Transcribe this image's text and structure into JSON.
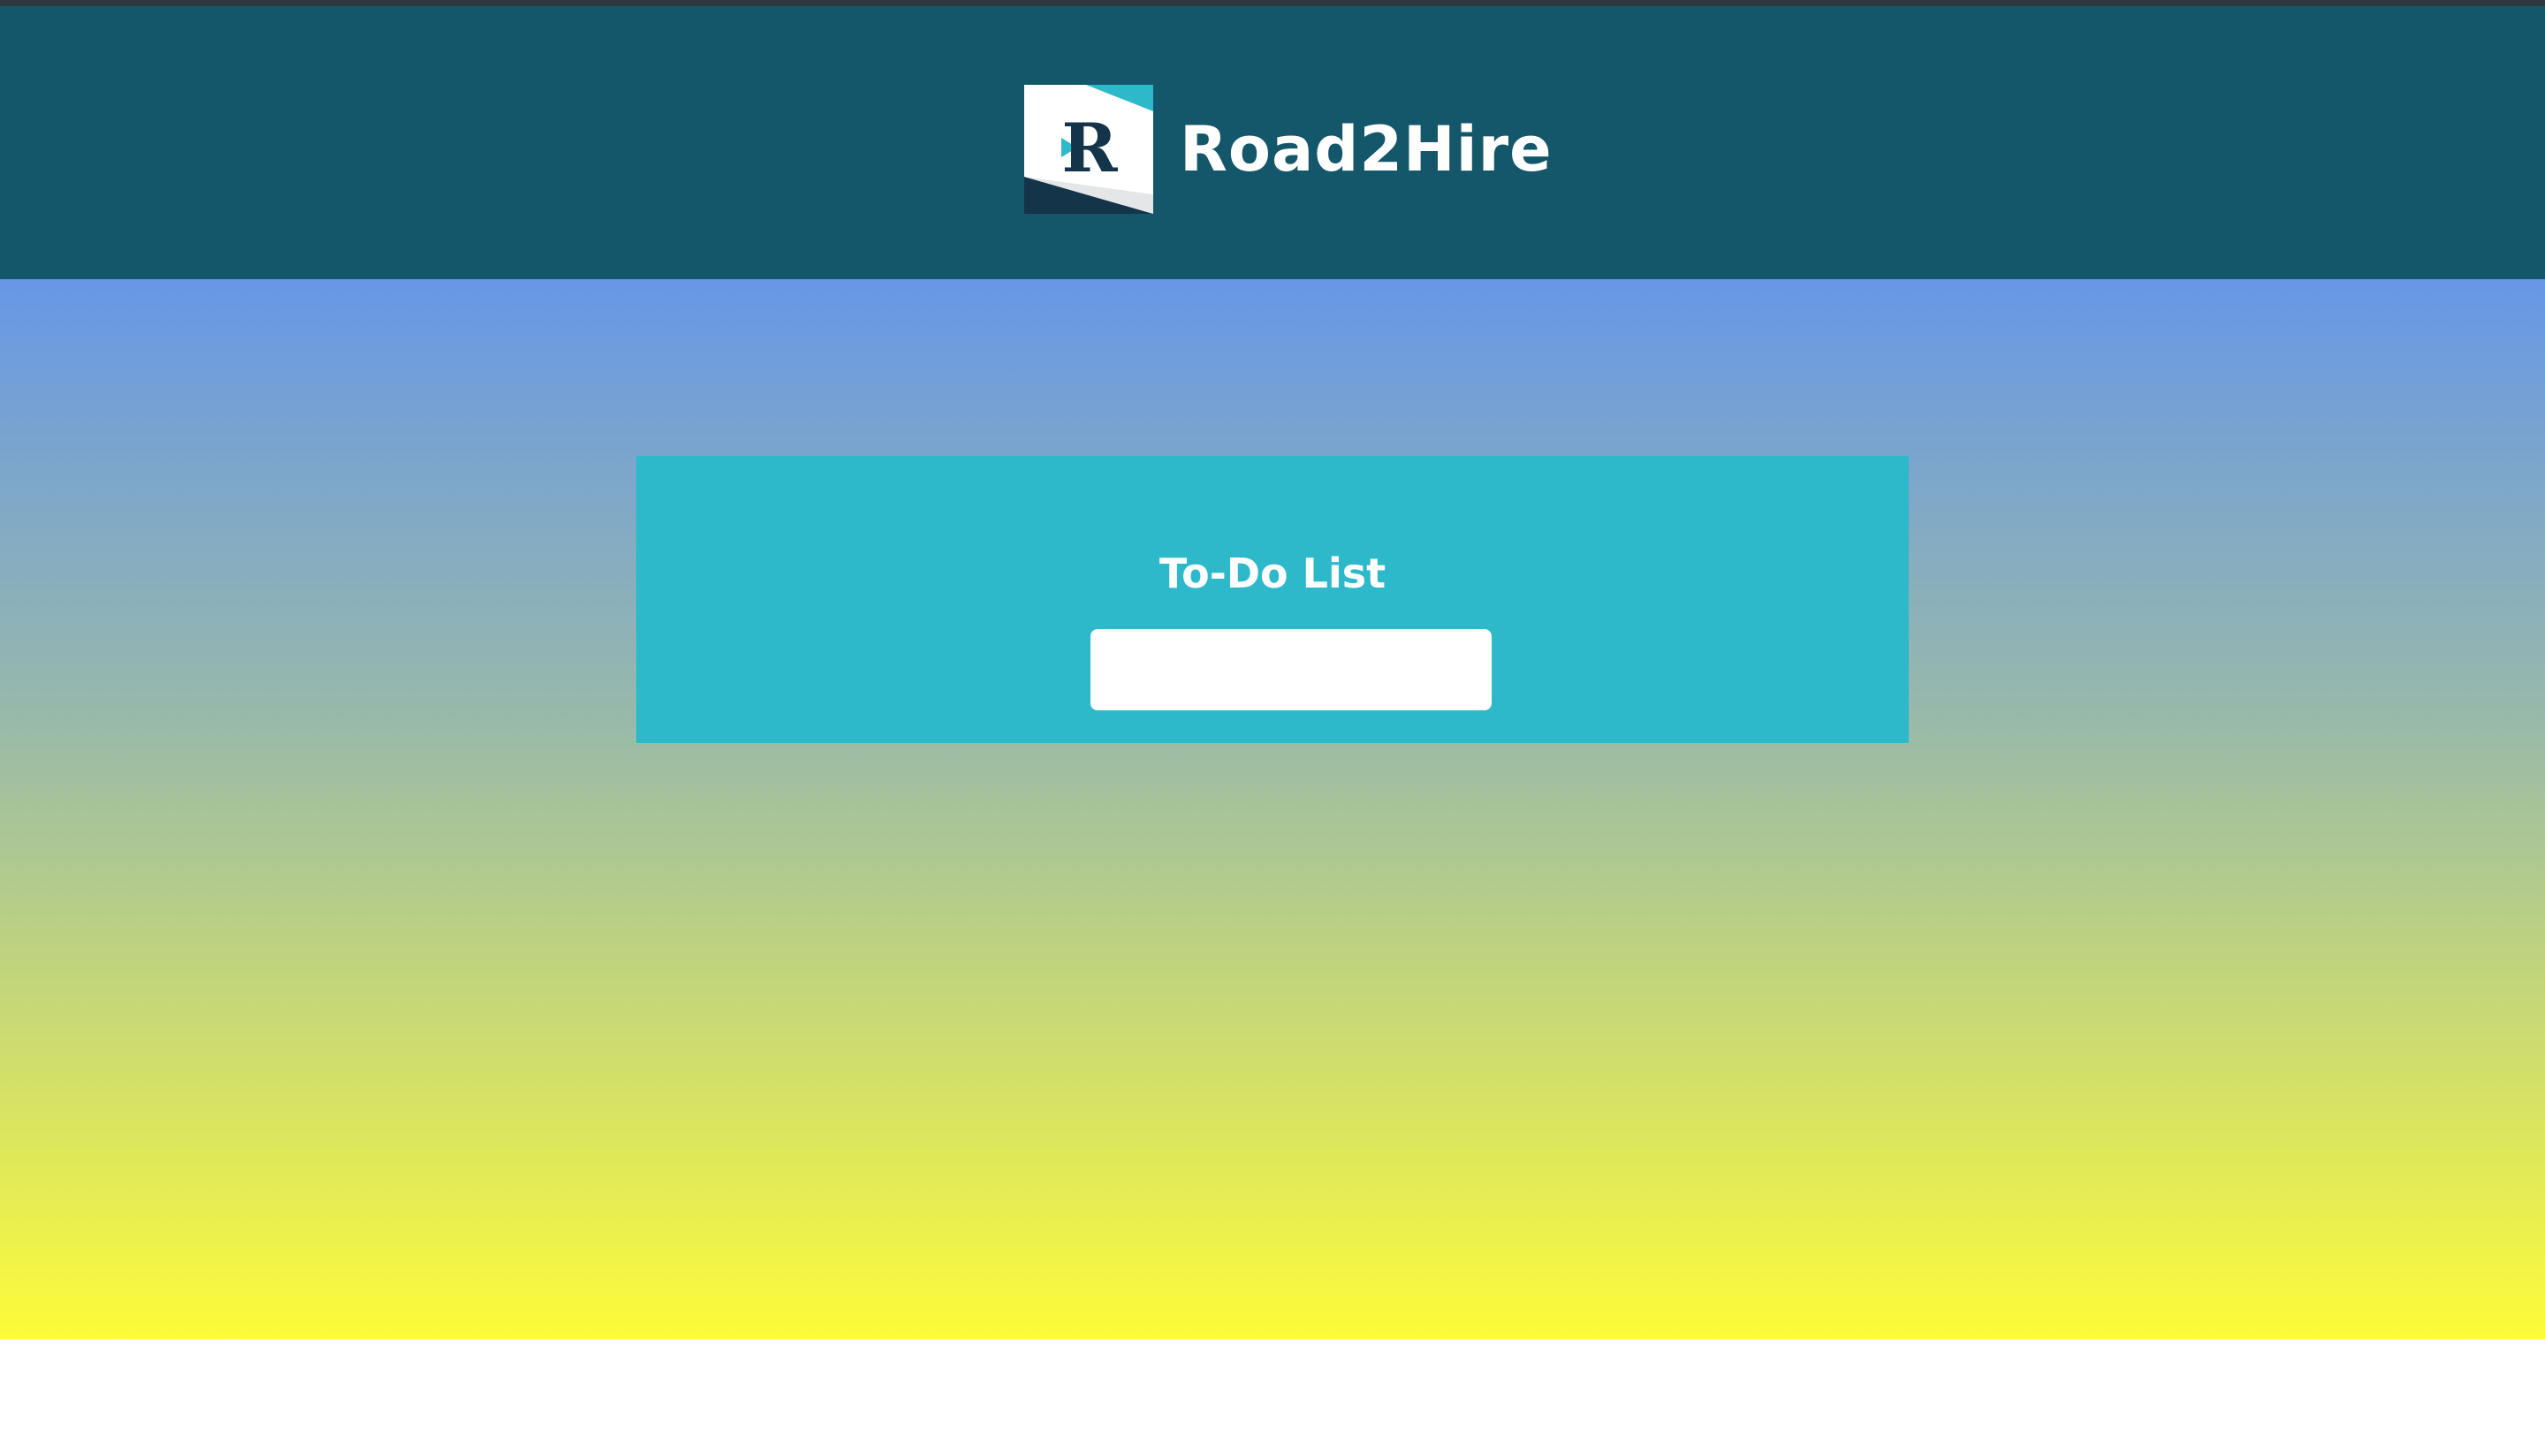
{
  "header": {
    "brand_name": "Road2Hire",
    "logo_letter": "R",
    "colors": {
      "background": "#14566a",
      "logo_teal": "#2eb9cb",
      "logo_navy": "#14344a"
    }
  },
  "hero": {
    "gradient_colors": [
      "#6797e6",
      "#99baa9",
      "#fdfc39"
    ]
  },
  "todo": {
    "title": "To-Do List",
    "input": {
      "value": "",
      "placeholder": ""
    },
    "card_color": "#2eb9cb"
  }
}
